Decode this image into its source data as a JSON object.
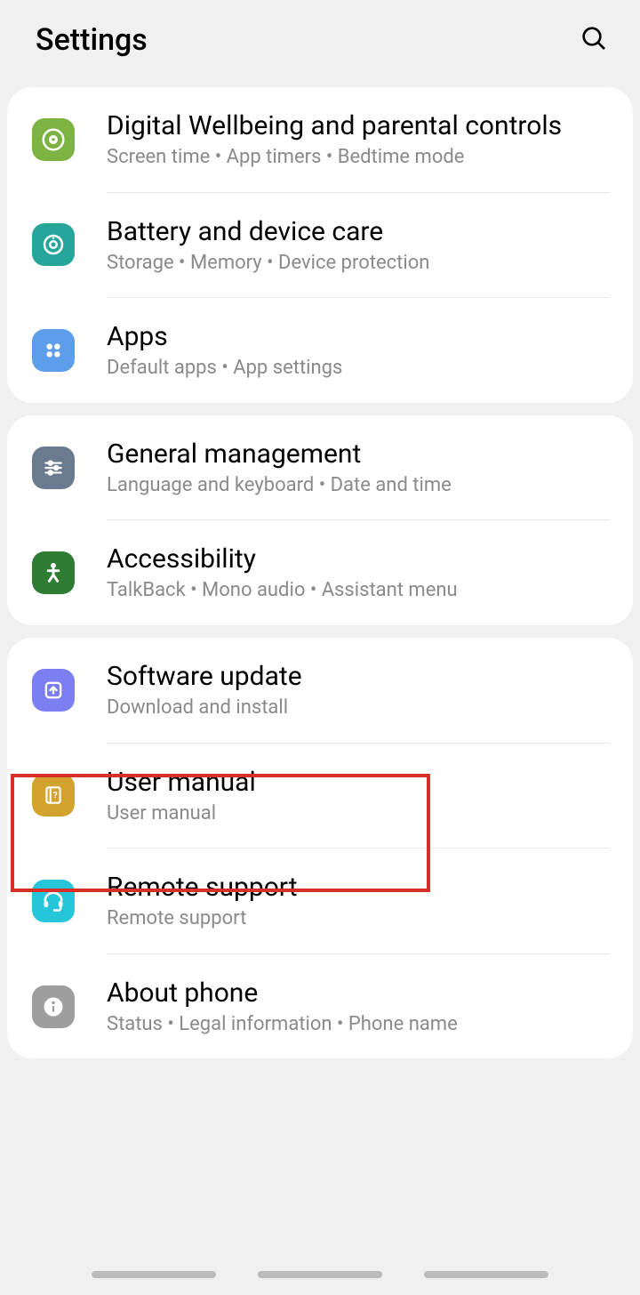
{
  "header": {
    "title": "Settings"
  },
  "groups": [
    {
      "items": [
        {
          "key": "wellbeing",
          "title": "Digital Wellbeing and parental controls",
          "subtitle": "Screen time  •  App timers  •  Bedtime mode"
        },
        {
          "key": "battery",
          "title": "Battery and device care",
          "subtitle": "Storage  •  Memory  •  Device protection"
        },
        {
          "key": "apps",
          "title": "Apps",
          "subtitle": "Default apps  •  App settings"
        }
      ]
    },
    {
      "items": [
        {
          "key": "general",
          "title": "General management",
          "subtitle": "Language and keyboard  •  Date and time"
        },
        {
          "key": "accessibility",
          "title": "Accessibility",
          "subtitle": "TalkBack  •  Mono audio  •  Assistant menu"
        }
      ]
    },
    {
      "items": [
        {
          "key": "software",
          "title": "Software update",
          "subtitle": "Download and install"
        },
        {
          "key": "manual",
          "title": "User manual",
          "subtitle": "User manual"
        },
        {
          "key": "remote",
          "title": "Remote support",
          "subtitle": "Remote support"
        },
        {
          "key": "about",
          "title": "About phone",
          "subtitle": "Status  •  Legal information  •  Phone name"
        }
      ]
    }
  ]
}
